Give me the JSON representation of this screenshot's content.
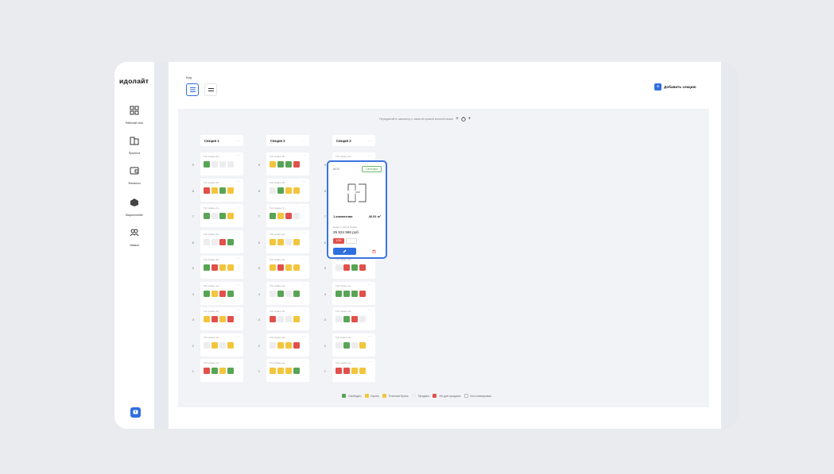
{
  "app": {
    "logo": "идолайт"
  },
  "sidebar": {
    "items": [
      {
        "label": "Рабочий стол",
        "icon": "dashboard-icon"
      },
      {
        "label": "Проекты",
        "icon": "buildings-icon"
      },
      {
        "label": "Финансы",
        "icon": "wallet-icon"
      },
      {
        "label": "Маркетплейс",
        "icon": "marketplace-icon"
      },
      {
        "label": "Заявки",
        "icon": "requests-icon"
      }
    ],
    "chat_icon": "chat-icon"
  },
  "header": {
    "view_label": "Вид",
    "add_section": "Добавить секцию"
  },
  "board": {
    "hint": "Передвигайте шахматку с зажатой правой кнопкой мыши",
    "zoom_in": "+",
    "zoom_out": "+",
    "sections": [
      {
        "title": "Секция 1",
        "dots": "···"
      },
      {
        "title": "Секция 2",
        "dots": "···"
      },
      {
        "title": "Секция 3",
        "dots": "···"
      }
    ],
    "floors": [
      {
        "num": "9",
        "type": "Тип этажа «9»"
      },
      {
        "num": "8",
        "type": "Тип этажа «8»"
      },
      {
        "num": "7",
        "type": "Тип этажа «7»"
      },
      {
        "num": "6",
        "type": "Тип этажа «6»"
      },
      {
        "num": "5",
        "type": "Тип этажа «5»"
      },
      {
        "num": "4",
        "type": "Тип этажа «4»"
      },
      {
        "num": "3",
        "type": "Тип этажа «3»"
      },
      {
        "num": "2",
        "type": "Тип этажа «2»"
      },
      {
        "num": "1",
        "type": "Тип этажа «1»"
      }
    ],
    "cells": [
      [
        [
          "g",
          "w",
          "w",
          "w"
        ],
        [
          "y",
          "g",
          "g",
          "r"
        ],
        [
          "w",
          "w",
          "w",
          "w"
        ]
      ],
      [
        [
          "r",
          "y",
          "g",
          "y"
        ],
        [
          "w",
          "g",
          "y",
          "y"
        ],
        [
          "w",
          "w",
          "w",
          "w"
        ]
      ],
      [
        [
          "g",
          "w",
          "g",
          "y"
        ],
        [
          "g",
          "y",
          "r",
          "w"
        ],
        [
          "w",
          "w",
          "w",
          "w"
        ]
      ],
      [
        [
          "w",
          "w",
          "r",
          "g"
        ],
        [
          "y",
          "y",
          "w",
          "y"
        ],
        [
          "w",
          "w",
          "w",
          "w"
        ]
      ],
      [
        [
          "g",
          "r",
          "y",
          "y"
        ],
        [
          "y",
          "r",
          "y",
          "y"
        ],
        [
          "w",
          "r",
          "g",
          "r"
        ]
      ],
      [
        [
          "g",
          "y",
          "r",
          "g"
        ],
        [
          "w",
          "g",
          "w",
          "g"
        ],
        [
          "g",
          "g",
          "g",
          "r"
        ]
      ],
      [
        [
          "y",
          "r",
          "y",
          "r"
        ],
        [
          "r",
          "w",
          "w",
          "y"
        ],
        [
          "w",
          "g",
          "r",
          "w"
        ]
      ],
      [
        [
          "w",
          "y",
          "w",
          "y"
        ],
        [
          "w",
          "y",
          "y",
          "r"
        ],
        [
          "w",
          "g",
          "w",
          "y"
        ]
      ],
      [
        [
          "r",
          "g",
          "y",
          "g"
        ],
        [
          "y",
          "y",
          "y",
          "g"
        ],
        [
          "r",
          "r",
          "y",
          "y"
        ]
      ]
    ]
  },
  "popup": {
    "number": "кв 91",
    "status": "Свободна",
    "rooms": "1-комнатная",
    "area": "40.51 м²",
    "payment": "Цена с учетом скидки",
    "price": "25 924 586 руб.",
    "discount": "10%"
  },
  "legend": [
    {
      "label": "Свободно",
      "color": "#58a455"
    },
    {
      "label": "Бронь",
      "color": "#f2c53d"
    },
    {
      "label": "Платная бронь",
      "color": "#f2c53d"
    },
    {
      "label": "Продано",
      "color": "#ededf0"
    },
    {
      "label": "Не для продажи",
      "color": "#e1504b"
    },
    {
      "label": "Без планировки",
      "color": "#ffffff"
    }
  ]
}
